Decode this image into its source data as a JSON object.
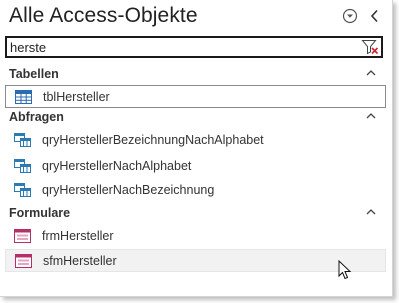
{
  "pane": {
    "title": "Alle Access-Objekte",
    "header_icons": [
      "dropdown-circle-icon",
      "chevron-left-icon"
    ]
  },
  "search": {
    "value": "herste",
    "clear_icon": "clear-filter-icon"
  },
  "groups": [
    {
      "label": "Tabellen",
      "items": [
        {
          "label": "tblHersteller",
          "icon": "table-icon",
          "state": "selected"
        }
      ]
    },
    {
      "label": "Abfragen",
      "items": [
        {
          "label": "qryHerstellerBezeichnungNachAlphabet",
          "icon": "query-icon"
        },
        {
          "label": "qryHerstellerNachAlphabet",
          "icon": "query-icon"
        },
        {
          "label": "qryHerstellerNachBezeichnung",
          "icon": "query-icon"
        }
      ]
    },
    {
      "label": "Formulare",
      "items": [
        {
          "label": "frmHersteller",
          "icon": "form-icon"
        },
        {
          "label": "sfmHersteller",
          "icon": "form-icon",
          "state": "hover"
        }
      ]
    }
  ],
  "colors": {
    "table_icon": "#2b6cb0",
    "query_icon": "#2a7bb5",
    "form_icon": "#b5306a",
    "clear_icon_x": "#d0232f"
  }
}
